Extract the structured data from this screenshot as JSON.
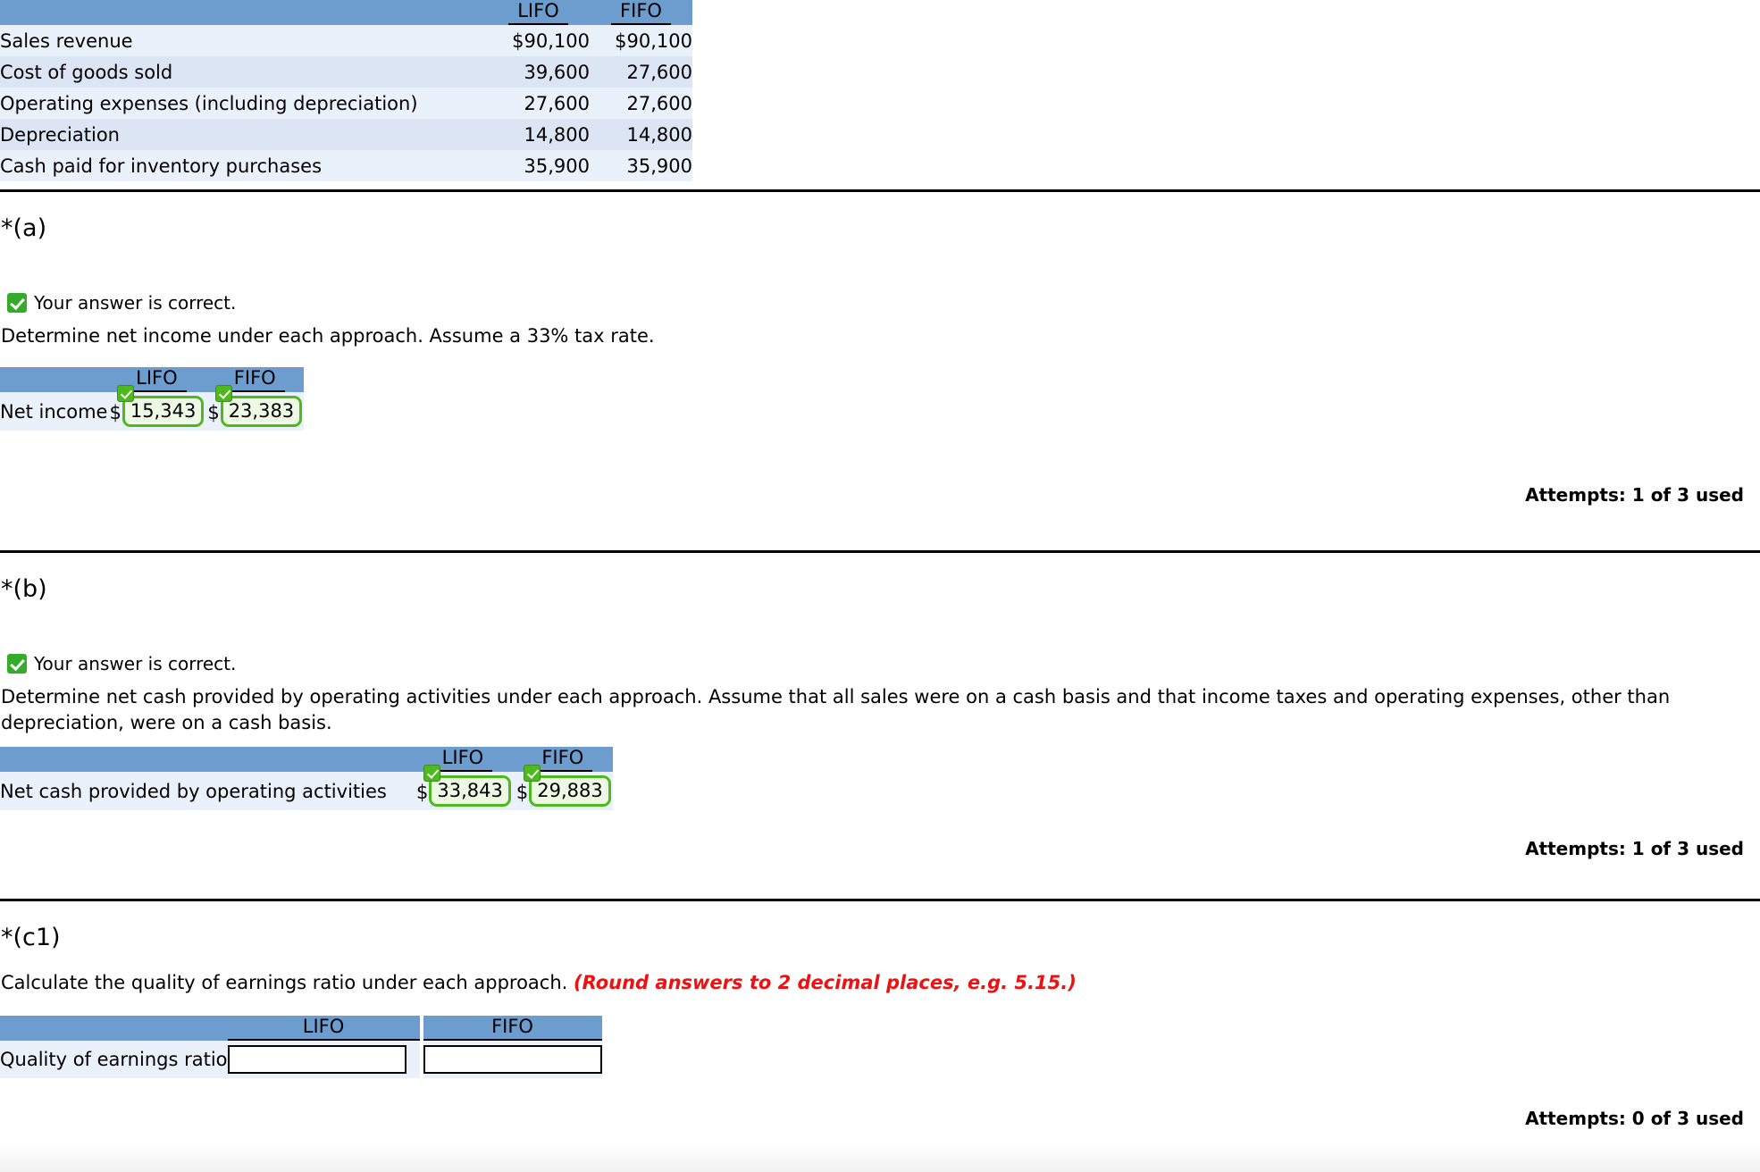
{
  "summary_table": {
    "columns": [
      "LIFO",
      "FIFO"
    ],
    "rows": [
      {
        "label": "Sales revenue",
        "lifo": "$90,100",
        "fifo": "$90,100"
      },
      {
        "label": "Cost of goods sold",
        "lifo": "39,600",
        "fifo": "27,600"
      },
      {
        "label": "Operating expenses (including depreciation)",
        "lifo": "27,600",
        "fifo": "27,600"
      },
      {
        "label": "Depreciation",
        "lifo": "14,800",
        "fifo": "14,800"
      },
      {
        "label": "Cash paid for inventory purchases",
        "lifo": "35,900",
        "fifo": "35,900"
      }
    ]
  },
  "sections": [
    {
      "title": "*(a)",
      "feedback": "Your answer is correct.",
      "prompt": "Determine net income under each approach. Assume a 33% tax rate.",
      "answer_table": {
        "columns": [
          "LIFO",
          "FIFO"
        ],
        "row_label": "Net income",
        "currency": "$",
        "lifo_value": "15,343",
        "fifo_value": "23,383"
      },
      "attempts": "Attempts: 1 of 3 used"
    },
    {
      "title": "*(b)",
      "feedback": "Your answer is correct.",
      "prompt": "Determine net cash provided by operating activities under each approach. Assume that all sales were on a cash basis and that income taxes and operating expenses, other than depreciation, were on a cash basis.",
      "answer_table": {
        "columns": [
          "LIFO",
          "FIFO"
        ],
        "row_label": "Net cash provided by operating activities",
        "currency": "$",
        "lifo_value": "33,843",
        "fifo_value": "29,883"
      },
      "attempts": "Attempts: 1 of 3 used"
    },
    {
      "title": "*(c1)",
      "prompt_plain": "Calculate the quality of earnings ratio under each approach. ",
      "prompt_note": "(Round answers to 2 decimal places, e.g. 5.15.)",
      "answer_table": {
        "columns": [
          "LIFO",
          "FIFO"
        ],
        "row_label": "Quality of earnings ratio",
        "lifo_value": "",
        "fifo_value": ""
      },
      "attempts": "Attempts: 0 of 3 used"
    }
  ],
  "colors": {
    "header_blue": "#6d9dce",
    "row_light": "#eaf1fb",
    "row_dark": "#dbe5f4",
    "correct_green": "#4fb81f",
    "note_red": "#ee1111"
  }
}
